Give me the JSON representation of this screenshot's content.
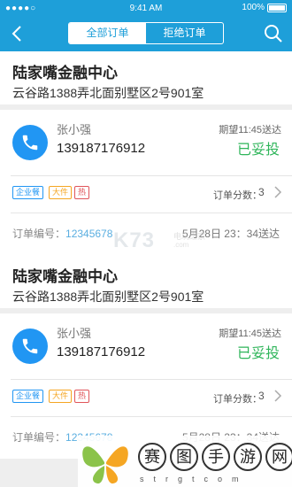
{
  "status_bar": {
    "signal": "●●●●○",
    "time": "9:41 AM",
    "battery": "100%"
  },
  "nav": {
    "tab_all": "全部订单",
    "tab_rejected": "拒绝订单"
  },
  "orders": [
    {
      "address_title": "陆家嘴金融中心",
      "address_detail": "云谷路1388弄北面别墅区2号901室",
      "customer_name": "张小强",
      "customer_phone": "139187176912",
      "expected": "期望11:45送达",
      "status": "已妥投",
      "tags": [
        "企业餐",
        "大件",
        "热"
      ],
      "score_label": "订单分数：",
      "score": "3",
      "order_no_label": "订单编号：",
      "order_no": "12345678",
      "delivered": "5月28日 23：34送达"
    },
    {
      "address_title": "陆家嘴金融中心",
      "address_detail": "云谷路1388弄北面别墅区2号901室",
      "customer_name": "张小强",
      "customer_phone": "139187176912",
      "expected": "期望11:45送达",
      "status": "已妥投",
      "tags": [
        "企业餐",
        "大件",
        "热"
      ],
      "score_label": "订单分数：",
      "score": "3",
      "order_no_label": "订单编号：",
      "order_no": "12345678",
      "delivered": "5月28日 23：34送达"
    }
  ],
  "watermark": {
    "brand": "K73",
    "cn": "电玩之家",
    "url": ".com"
  },
  "footer_brand": {
    "chars": [
      "赛",
      "图",
      "手",
      "游",
      "网"
    ],
    "sub": "strgtcom"
  },
  "colors": {
    "primary": "#1e9fd9",
    "status_green": "#2fb55a",
    "phone_blue": "#2196f3"
  }
}
